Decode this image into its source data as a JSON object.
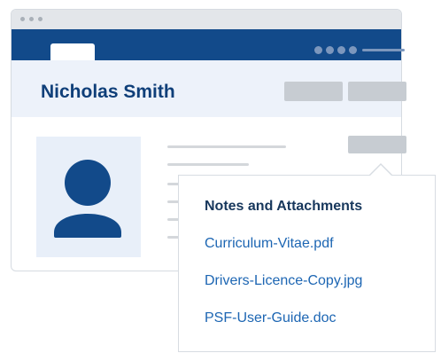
{
  "profile": {
    "name": "Nicholas Smith"
  },
  "popover": {
    "title": "Notes and Attachments",
    "attachments": [
      "Curriculum-Vitae.pdf",
      "Drivers-Licence-Copy.jpg",
      "PSF-User-Guide.doc"
    ]
  },
  "icons": {
    "avatar": "user-silhouette-icon"
  },
  "colors": {
    "navbar": "#124a8a",
    "header_bg": "#edf2fa",
    "name_text": "#0f3f79",
    "avatar_fill": "#124a8a",
    "link": "#1d66b3",
    "popover_title": "#17375c"
  }
}
